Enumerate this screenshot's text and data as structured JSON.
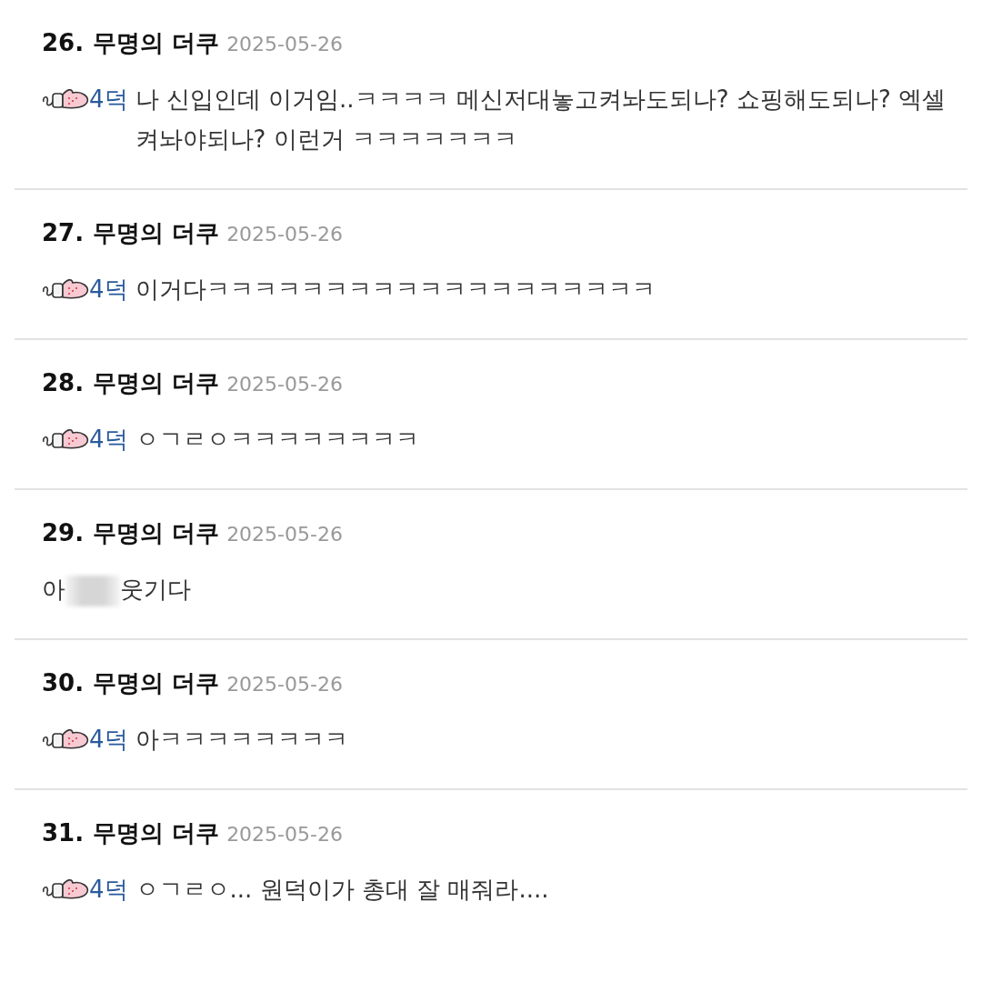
{
  "comments": [
    {
      "number": "26.",
      "author": "무명의 더쿠",
      "date": "2025-05-26",
      "body": [
        {
          "kind": "mention",
          "text": "4덕"
        },
        {
          "kind": "text",
          "text": "나 신입인데 이거임..ㅋㅋㅋㅋ 메신저대놓고켜놔도되나? 쇼핑해도되나? 엑셀켜놔야되나? 이런거 ㅋㅋㅋㅋㅋㅋㅋ"
        }
      ]
    },
    {
      "number": "27.",
      "author": "무명의 더쿠",
      "date": "2025-05-26",
      "body": [
        {
          "kind": "mention",
          "text": "4덕"
        },
        {
          "kind": "text",
          "text": "이거다ㅋㅋㅋㅋㅋㅋㅋㅋㅋㅋㅋㅋㅋㅋㅋㅋㅋㅋㅋ"
        }
      ]
    },
    {
      "number": "28.",
      "author": "무명의 더쿠",
      "date": "2025-05-26",
      "body": [
        {
          "kind": "mention",
          "text": "4덕"
        },
        {
          "kind": "text",
          "text": "ㅇㄱㄹㅇㅋㅋㅋㅋㅋㅋㅋㅋ"
        }
      ]
    },
    {
      "number": "29.",
      "author": "무명의 더쿠",
      "date": "2025-05-26",
      "body": [
        {
          "kind": "text",
          "text": "아"
        },
        {
          "kind": "blur"
        },
        {
          "kind": "text",
          "text": "웃기다"
        }
      ]
    },
    {
      "number": "30.",
      "author": "무명의 더쿠",
      "date": "2025-05-26",
      "body": [
        {
          "kind": "mention",
          "text": "4덕"
        },
        {
          "kind": "text",
          "text": "아ㅋㅋㅋㅋㅋㅋㅋㅋ"
        }
      ]
    },
    {
      "number": "31.",
      "author": "무명의 더쿠",
      "date": "2025-05-26",
      "body": [
        {
          "kind": "mention",
          "text": "4덕"
        },
        {
          "kind": "text",
          "text": "ㅇㄱㄹㅇ... 원덕이가 총대 잘 매줘라...."
        }
      ]
    }
  ]
}
